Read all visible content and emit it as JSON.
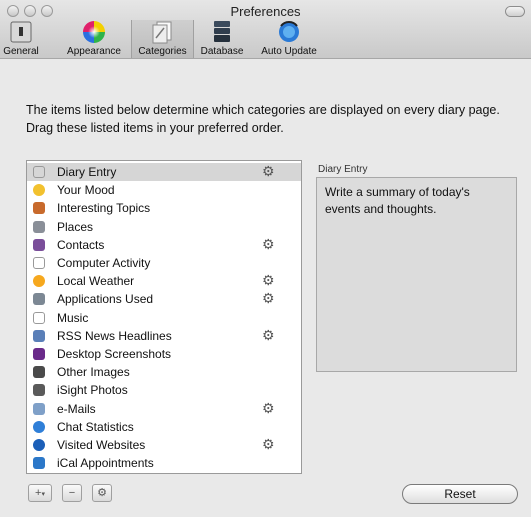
{
  "window": {
    "title": "Preferences"
  },
  "toolbar": {
    "items": [
      {
        "label": "General",
        "icon": "switch-icon"
      },
      {
        "label": "Appearance",
        "icon": "color-wheel-icon"
      },
      {
        "label": "Categories",
        "icon": "categories-icon",
        "selected": true
      },
      {
        "label": "Database",
        "icon": "database-icon"
      },
      {
        "label": "Auto Update",
        "icon": "globe-update-icon"
      }
    ]
  },
  "intro_text": "The items listed below determine which categories are displayed on every diary page. Drag these listed items in your preferred order.",
  "categories": [
    {
      "label": "Diary Entry",
      "icon": "pencil-icon",
      "gear": true,
      "selected": true
    },
    {
      "label": "Your Mood",
      "icon": "smiley-icon",
      "gear": false
    },
    {
      "label": "Interesting Topics",
      "icon": "topics-icon",
      "gear": false
    },
    {
      "label": "Places",
      "icon": "places-icon",
      "gear": false
    },
    {
      "label": "Contacts",
      "icon": "contacts-icon",
      "gear": true
    },
    {
      "label": "Computer Activity",
      "icon": "activity-icon",
      "gear": false
    },
    {
      "label": "Local Weather",
      "icon": "sun-icon",
      "gear": true
    },
    {
      "label": "Applications Used",
      "icon": "applications-icon",
      "gear": true
    },
    {
      "label": "Music",
      "icon": "headphones-icon",
      "gear": false
    },
    {
      "label": "RSS News Headlines",
      "icon": "rss-icon",
      "gear": true
    },
    {
      "label": "Desktop Screenshots",
      "icon": "monitor-icon",
      "gear": false
    },
    {
      "label": "Other Images",
      "icon": "image-icon",
      "gear": false
    },
    {
      "label": "iSight Photos",
      "icon": "camera-icon",
      "gear": false
    },
    {
      "label": "e-Mails",
      "icon": "envelope-icon",
      "gear": true
    },
    {
      "label": "Chat Statistics",
      "icon": "chat-icon",
      "gear": false
    },
    {
      "label": "Visited Websites",
      "icon": "globe-icon",
      "gear": true
    },
    {
      "label": "iCal Appointments",
      "icon": "calendar-icon",
      "gear": false
    }
  ],
  "detail": {
    "title": "Diary Entry",
    "description": "Write a summary of today's events and thoughts."
  },
  "buttons": {
    "add": "+",
    "add_menu": "▾",
    "remove": "−",
    "action": "⚙",
    "reset": "Reset"
  },
  "icon_colors": {
    "smiley-icon": "#f2c12e",
    "topics-icon": "#c86a2c",
    "places-icon": "#8a8f98",
    "contacts-icon": "#7a4e9a",
    "sun-icon": "#f6a81e",
    "applications-icon": "#7c8894",
    "rss-icon": "#5a7fb8",
    "monitor-icon": "#6a2a8a",
    "image-icon": "#4a4a4a",
    "camera-icon": "#5a5a5a",
    "envelope-icon": "#7fa0c8",
    "chat-icon": "#2f7fd8",
    "globe-icon": "#1b5fb8",
    "calendar-icon": "#2c78c9"
  }
}
